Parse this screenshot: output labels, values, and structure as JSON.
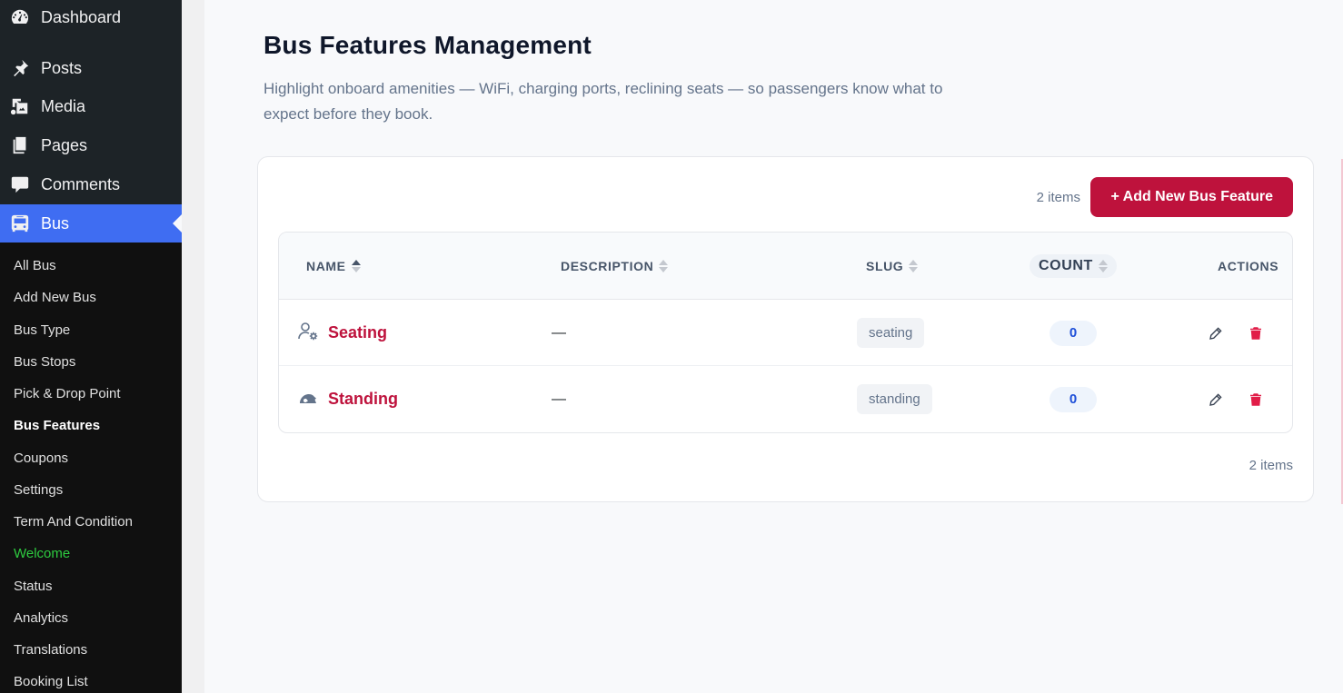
{
  "sidebar": {
    "top_items": [
      {
        "label": "Dashboard",
        "icon": "dashboard-icon"
      },
      {
        "label": "Posts",
        "icon": "pushpin-icon"
      },
      {
        "label": "Media",
        "icon": "media-icon"
      },
      {
        "label": "Pages",
        "icon": "pages-icon"
      },
      {
        "label": "Comments",
        "icon": "comment-icon"
      },
      {
        "label": "Bus",
        "icon": "bus-icon"
      }
    ],
    "sub_items": [
      "All Bus",
      "Add New Bus",
      "Bus Type",
      "Bus Stops",
      "Pick & Drop Point",
      "Bus Features",
      "Coupons",
      "Settings",
      "Term And Condition",
      "Welcome",
      "Status",
      "Analytics",
      "Translations",
      "Booking List"
    ],
    "active_sub": "Bus Features",
    "accent_color": "#3f6df2",
    "welcome_color": "#2ecc40"
  },
  "page": {
    "title": "Bus Features Management",
    "description": "Highlight onboard amenities — WiFi, charging ports, reclining seats — so passengers know what to expect before they book."
  },
  "toolbar": {
    "item_count": "2 items",
    "add_button_label": "+ Add New Bus Feature",
    "button_color": "#be123c"
  },
  "table": {
    "headers": {
      "name": "NAME",
      "description": "DESCRIPTION",
      "slug": "SLUG",
      "count": "COUNT",
      "actions": "ACTIONS"
    },
    "rows": [
      {
        "name": "Seating",
        "icon": "user-gear-icon",
        "description": "—",
        "slug": "seating",
        "count": "0"
      },
      {
        "name": "Standing",
        "icon": "reclining-seat-icon",
        "description": "—",
        "slug": "standing",
        "count": "0"
      }
    ]
  },
  "footer": {
    "item_count": "2 items"
  }
}
